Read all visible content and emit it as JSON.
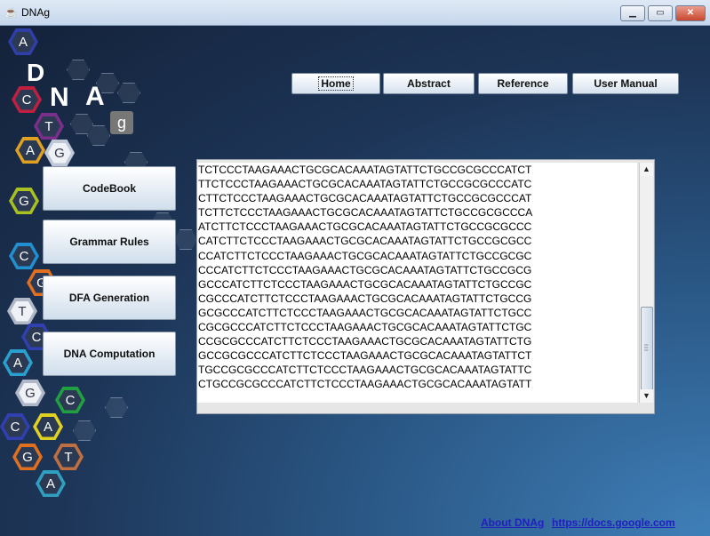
{
  "window": {
    "title": "DNAg",
    "controls": {
      "minimize_icon": "minimize-icon",
      "maximize_icon": "maximize-icon",
      "close_icon": "close-icon"
    }
  },
  "logo": {
    "letters": [
      "A",
      "D",
      "C",
      "G",
      "T",
      "N",
      "A",
      "g",
      "C",
      "T",
      "A",
      "C",
      "A",
      "G"
    ],
    "big": [
      "D",
      "N",
      "A",
      "g"
    ]
  },
  "nav": {
    "items": [
      {
        "label": "Home",
        "focused": true
      },
      {
        "label": "Abstract"
      },
      {
        "label": "Reference"
      },
      {
        "label": "User Manual"
      }
    ]
  },
  "side_menu": {
    "items": [
      {
        "label": "CodeBook"
      },
      {
        "label": "Grammar Rules"
      },
      {
        "label": "DFA Generation"
      },
      {
        "label": "DNA Computation"
      }
    ]
  },
  "sequence_area": {
    "lines": [
      "TCTCCCTAAGAAACTGCGCACAAATAGTATTCTGCCGCGCCCATCT",
      "TTCTCCCTAAGAAACTGCGCACAAATAGTATTCTGCCGCGCCCATC",
      "CTTCTCCCTAAGAAACTGCGCACAAATAGTATTCTGCCGCGCCCAT",
      "TCTTCTCCCTAAGAAACTGCGCACAAATAGTATTCTGCCGCGCCCA",
      "ATCTTCTCCCTAAGAAACTGCGCACAAATAGTATTCTGCCGCGCCC",
      "CATCTTCTCCCTAAGAAACTGCGCACAAATAGTATTCTGCCGCGCC",
      "CCATCTTCTCCCTAAGAAACTGCGCACAAATAGTATTCTGCCGCGC",
      "CCCATCTTCTCCCTAAGAAACTGCGCACAAATAGTATTCTGCCGCG",
      "GCCCATCTTCTCCCTAAGAAACTGCGCACAAATAGTATTCTGCCGC",
      "CGCCCATCTTCTCCCTAAGAAACTGCGCACAAATAGTATTCTGCCG",
      "GCGCCCATCTTCTCCCTAAGAAACTGCGCACAAATAGTATTCTGCC",
      "CGCGCCCATCTTCTCCCTAAGAAACTGCGCACAAATAGTATTCTGC",
      "CCGCGCCCATCTTCTCCCTAAGAAACTGCGCACAAATAGTATTCTG",
      "GCCGCGCCCATCTTCTCCCTAAGAAACTGCGCACAAATAGTATTCT",
      "TGCCGCGCCCATCTTCTCCCTAAGAAACTGCGCACAAATAGTATTC",
      "CTGCCGCGCCCATCTTCTCCCTAAGAAACTGCGCACAAATAGTATT"
    ]
  },
  "footer": {
    "about_link": "About DNAg",
    "docs_link": "https://docs.google.com"
  }
}
